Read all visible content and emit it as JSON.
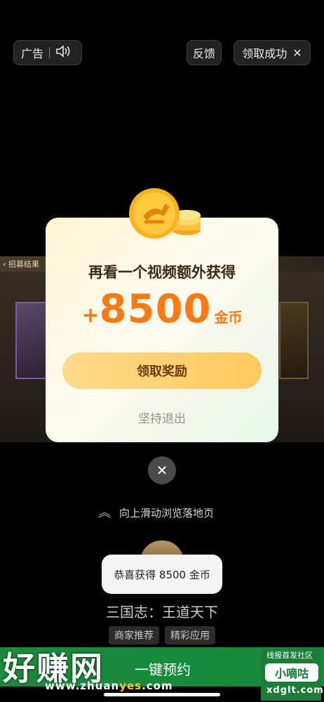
{
  "topbar": {
    "ad_label": "广告",
    "feedback_label": "反馈",
    "reward_success_label": "领取成功",
    "close_glyph": "✕"
  },
  "background_game": {
    "header_text": "招募结果"
  },
  "modal": {
    "title": "再看一个视频额外获得",
    "amount_prefix": "+",
    "amount": "8500",
    "amount_unit": "金币",
    "claim_button": "领取奖励",
    "quit_link": "坚持退出",
    "icon": "gold-coin-icon"
  },
  "close_button_glyph": "✕",
  "swipe_hint": "向上滑动浏览落地页",
  "toast": "恭喜获得 8500 金币",
  "app": {
    "name": "三国志：王道天下",
    "tags": [
      "商家推荐",
      "精彩应用"
    ]
  },
  "cta": {
    "label": "一键预约"
  },
  "watermarks": {
    "big_text": "好赚网",
    "url_prefix": "www.zhuan",
    "url_highlight": "yes",
    "url_suffix": ".com",
    "right_top": "线报首发社区",
    "right_badge": "小嘀咕",
    "right_domain": "xdglt.com"
  },
  "colors": {
    "accent_orange": "#ff7a12",
    "cta_green": "#1b8a3c"
  }
}
